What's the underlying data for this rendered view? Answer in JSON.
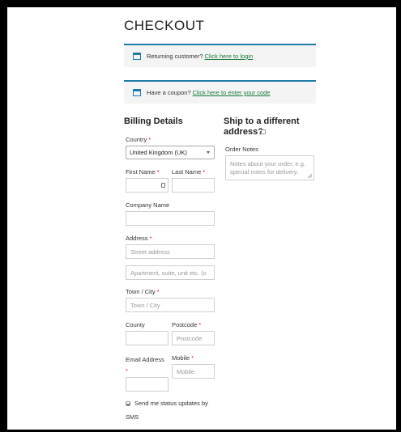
{
  "page": {
    "title": "CHECKOUT"
  },
  "notices": {
    "returning": {
      "text": "Returning customer?",
      "link": "Click here to login",
      "icon": "calendar-icon"
    },
    "coupon": {
      "text": "Have a coupon?",
      "link": "Click here to enter your code",
      "icon": "calendar-icon"
    }
  },
  "billing": {
    "heading": "Billing Details",
    "country": {
      "label": "Country",
      "required": "*",
      "value": "United Kingdom (UK)"
    },
    "first_name": {
      "label": "First Name",
      "required": "*",
      "value": ""
    },
    "last_name": {
      "label": "Last Name",
      "required": "*",
      "value": ""
    },
    "company": {
      "label": "Company Name",
      "value": ""
    },
    "address": {
      "label": "Address",
      "required": "*",
      "placeholder1": "Street address",
      "placeholder2": "Apartment, suite, unit etc. (o"
    },
    "city": {
      "label": "Town / City",
      "required": "*",
      "placeholder": "Town / City"
    },
    "county": {
      "label": "County",
      "value": ""
    },
    "postcode": {
      "label": "Postcode",
      "required": "*",
      "placeholder": "Postcode"
    },
    "email": {
      "label": "Email Address",
      "required": "*",
      "value": ""
    },
    "mobile": {
      "label": "Mobile",
      "required": "*",
      "placeholder": "Mobile"
    },
    "sms": {
      "line1": "Send me status updates by",
      "line2": "SMS",
      "checked": true
    }
  },
  "shipping": {
    "heading_line1": "Ship to a different",
    "heading_line2": "address?",
    "checked": false,
    "order_notes": {
      "label": "Order Notes",
      "placeholder_line1": "Notes about your order, e.g.",
      "placeholder_line2": "special notes for delivery."
    }
  },
  "colors": {
    "accent": "#1f7aa8",
    "link": "#1a7a3a",
    "required": "#d21f1f"
  }
}
